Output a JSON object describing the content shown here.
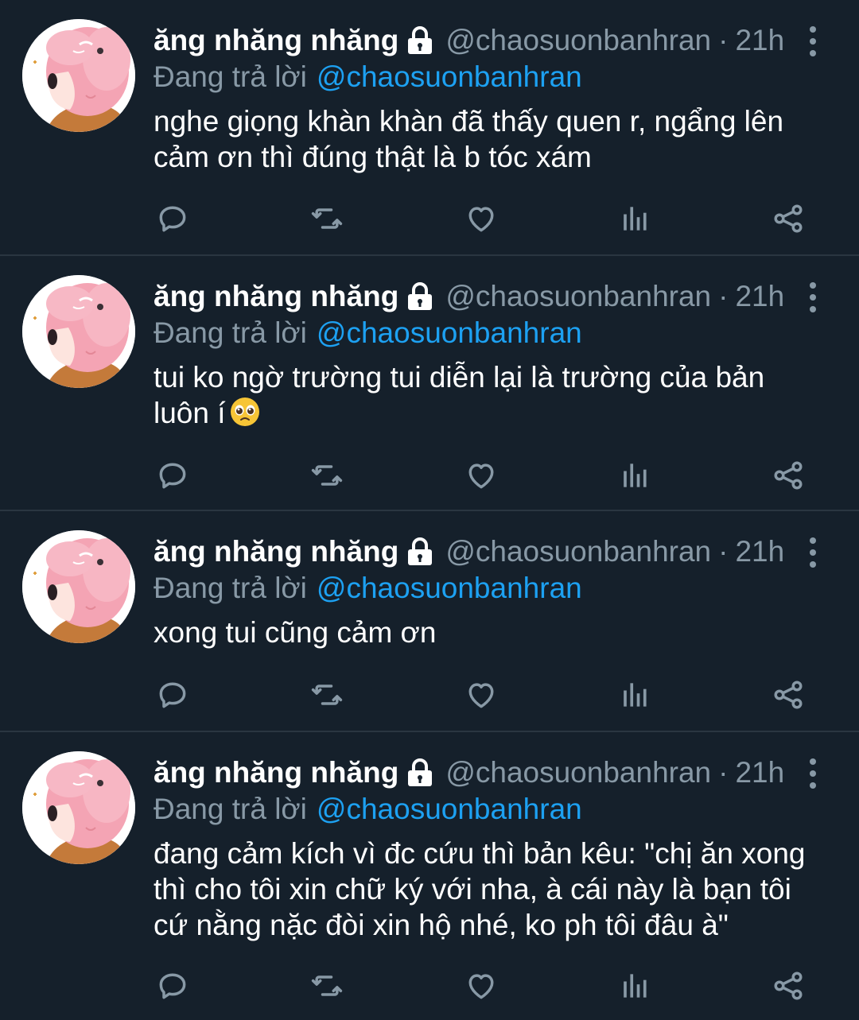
{
  "colors": {
    "background": "#15202b",
    "divider": "#2a3641",
    "secondary_text": "#8899a6",
    "mention": "#1da1f2",
    "primary_text": "#ffffff"
  },
  "tweets": [
    {
      "display_name": "ăng nhăng nhăng",
      "handle": "@chaosuonbanhran",
      "separator": "·",
      "time": "21h",
      "reply_prefix": "Đang trả lời",
      "reply_to": "@chaosuonbanhran",
      "text": "nghe giọng khàn khàn đã thấy quen r, ngẩng lên\ncảm ơn thì đúng thật là b tóc xám",
      "emoji": ""
    },
    {
      "display_name": "ăng nhăng nhăng",
      "handle": "@chaosuonbanhran",
      "separator": "·",
      "time": "21h",
      "reply_prefix": "Đang trả lời",
      "reply_to": "@chaosuonbanhran",
      "text": "tui ko ngờ trường tui diễn lại là trường của bản\nluôn í",
      "emoji": "pleading-face-icon"
    },
    {
      "display_name": "ăng nhăng nhăng",
      "handle": "@chaosuonbanhran",
      "separator": "·",
      "time": "21h",
      "reply_prefix": "Đang trả lời",
      "reply_to": "@chaosuonbanhran",
      "text": "xong tui cũng cảm ơn",
      "emoji": ""
    },
    {
      "display_name": "ăng nhăng nhăng",
      "handle": "@chaosuonbanhran",
      "separator": "·",
      "time": "21h",
      "reply_prefix": "Đang trả lời",
      "reply_to": "@chaosuonbanhran",
      "text": "đang cảm kích vì đc cứu thì bản kêu: \"chị ăn xong\nthì cho tôi xin chữ ký với nha, à cái này là bạn tôi\ncứ nằng nặc đòi xin hộ nhé, ko ph tôi đâu à\"",
      "emoji": ""
    }
  ],
  "action_icons": [
    "reply-icon",
    "retweet-icon",
    "like-icon",
    "analytics-icon",
    "share-icon"
  ],
  "header_icons": [
    "lock-icon",
    "more-options-icon"
  ]
}
